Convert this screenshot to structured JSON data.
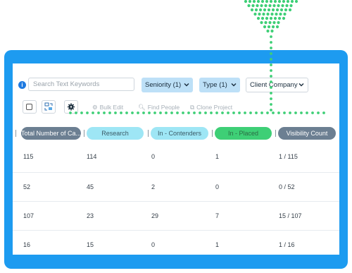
{
  "filters": {
    "search_placeholder": "Search Text Keywords",
    "seniority": "Seniority (1)",
    "type": "Type (1)",
    "client_company": "Client Company"
  },
  "toolbar": {
    "bulk_edit": "Bulk Edit",
    "find_people": "Find People",
    "clone_project": "Clone Project"
  },
  "columns": [
    {
      "label": "Total Number of Ca...",
      "bg": "#6c7f92",
      "color": "#ffffff"
    },
    {
      "label": "Research",
      "bg": "#9ee6f5",
      "color": "#3b5a66"
    },
    {
      "label": "In - Contenders",
      "bg": "#9ee6f5",
      "color": "#3b5a66"
    },
    {
      "label": "In - Placed",
      "bg": "#3ecf76",
      "color": "#2a6a43"
    },
    {
      "label": "Visibility Count",
      "bg": "#6c7f92",
      "color": "#ffffff"
    }
  ],
  "rows": [
    [
      "115",
      "114",
      "0",
      "1",
      "1 / 115"
    ],
    [
      "52",
      "45",
      "2",
      "0",
      "0 / 52"
    ],
    [
      "107",
      "23",
      "29",
      "7",
      "15 / 107"
    ],
    [
      "16",
      "15",
      "0",
      "1",
      "1 / 16"
    ]
  ],
  "colors": {
    "frame": "#1d9bf0",
    "accent_dots": "#3ecf76",
    "selected_filter": "#bde0f7"
  }
}
